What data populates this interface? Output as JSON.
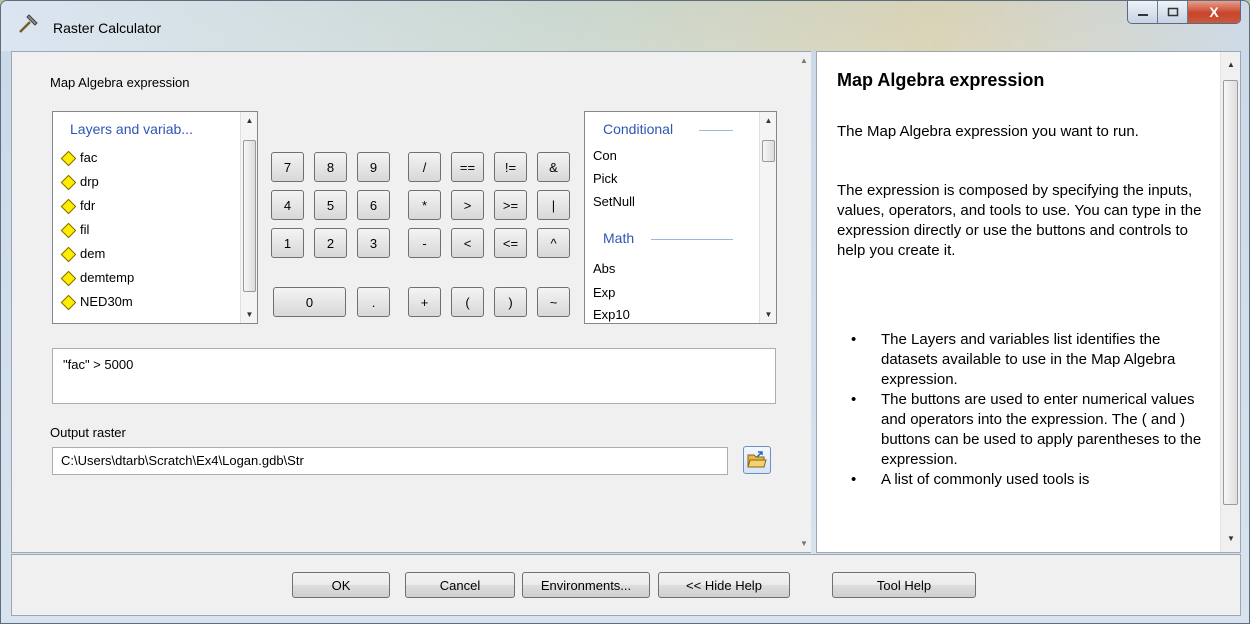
{
  "window": {
    "title": "Raster Calculator",
    "controls": {
      "minimize": "–",
      "maximize": "□",
      "close": "X"
    }
  },
  "left": {
    "map_algebra_label": "Map Algebra expression",
    "layers": {
      "header": "Layers and variab...",
      "items": [
        "fac",
        "drp",
        "fdr",
        "fil",
        "dem",
        "demtemp",
        "NED30m"
      ]
    },
    "keypad": {
      "row1": [
        "7",
        "8",
        "9",
        "/",
        "==",
        "!=",
        "&"
      ],
      "row2": [
        "4",
        "5",
        "6",
        "*",
        ">",
        ">=",
        "|"
      ],
      "row3": [
        "1",
        "2",
        "3",
        "-",
        "<",
        "<=",
        "^"
      ],
      "row4": [
        "0",
        ".",
        "+",
        "(",
        ")",
        "~"
      ]
    },
    "tools": {
      "conditional_header": "Conditional",
      "conditional_items": [
        "Con",
        "Pick",
        "SetNull"
      ],
      "math_header": "Math",
      "math_items": [
        "Abs",
        "Exp",
        "Exp10"
      ]
    },
    "expression": "\"fac\" > 5000",
    "output_label": "Output raster",
    "output_value": "C:\\Users\\dtarb\\Scratch\\Ex4\\Logan.gdb\\Str"
  },
  "help": {
    "title": "Map Algebra expression",
    "p1": "The Map Algebra expression you want to run.",
    "p2": "The expression is composed by specifying the inputs, values, operators, and tools to use. You can type in the expression directly or use the buttons and controls to help you create it.",
    "bullets": [
      "The Layers and variables list identifies the datasets available to use in the Map Algebra expression.",
      "The buttons are used to enter numerical values and operators into the expression. The ( and ) buttons can be used to apply parentheses to the expression.",
      "A list of commonly used tools is"
    ]
  },
  "buttons": {
    "ok": "OK",
    "cancel": "Cancel",
    "environments": "Environments...",
    "hide_help": "<< Hide Help",
    "tool_help": "Tool Help"
  },
  "colors": {
    "layer_diamond": "#ffec00",
    "list_header": "#2e56b5",
    "close_button": "#c7442a"
  }
}
